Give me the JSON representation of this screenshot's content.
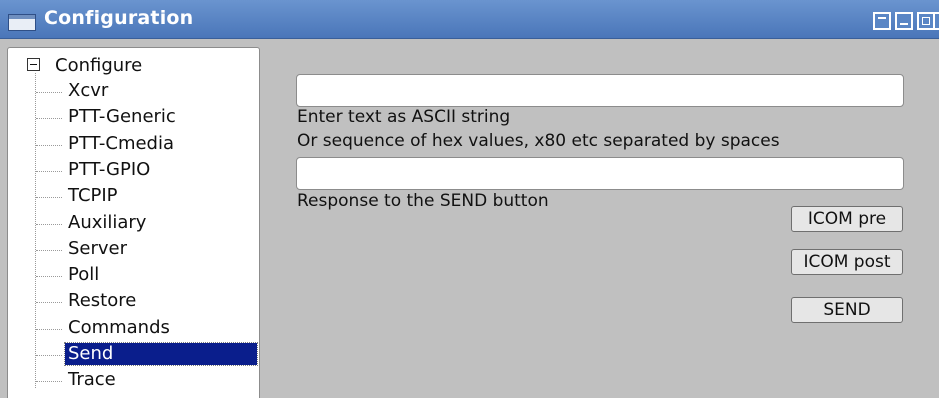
{
  "window": {
    "title": "Configuration",
    "icons": {
      "app": "window-icon",
      "shade": "shade-icon",
      "minimize": "minimize-icon",
      "maximize": "maximize-icon",
      "close": "close-icon"
    }
  },
  "tree": {
    "root": "Configure",
    "items": [
      {
        "label": "Xcvr",
        "selected": false
      },
      {
        "label": "PTT-Generic",
        "selected": false
      },
      {
        "label": "PTT-Cmedia",
        "selected": false
      },
      {
        "label": "PTT-GPIO",
        "selected": false
      },
      {
        "label": "TCPIP",
        "selected": false
      },
      {
        "label": "Auxiliary",
        "selected": false
      },
      {
        "label": "Server",
        "selected": false
      },
      {
        "label": "Poll",
        "selected": false
      },
      {
        "label": "Restore",
        "selected": false
      },
      {
        "label": "Commands",
        "selected": false
      },
      {
        "label": "Send",
        "selected": true
      },
      {
        "label": "Trace",
        "selected": false
      }
    ]
  },
  "send": {
    "command_value": "",
    "hint_line1": "Enter text as ASCII string",
    "hint_line2": "Or sequence of hex values, x80 etc separated by spaces",
    "response_value": "",
    "response_label": "Response to the SEND button",
    "icom_pre_label": "ICOM pre",
    "icom_post_label": "ICOM post",
    "send_label": "SEND"
  },
  "colors": {
    "titlebar": "#5a86c5",
    "selection": "#0a1e8c",
    "background": "#c0c0c0"
  }
}
